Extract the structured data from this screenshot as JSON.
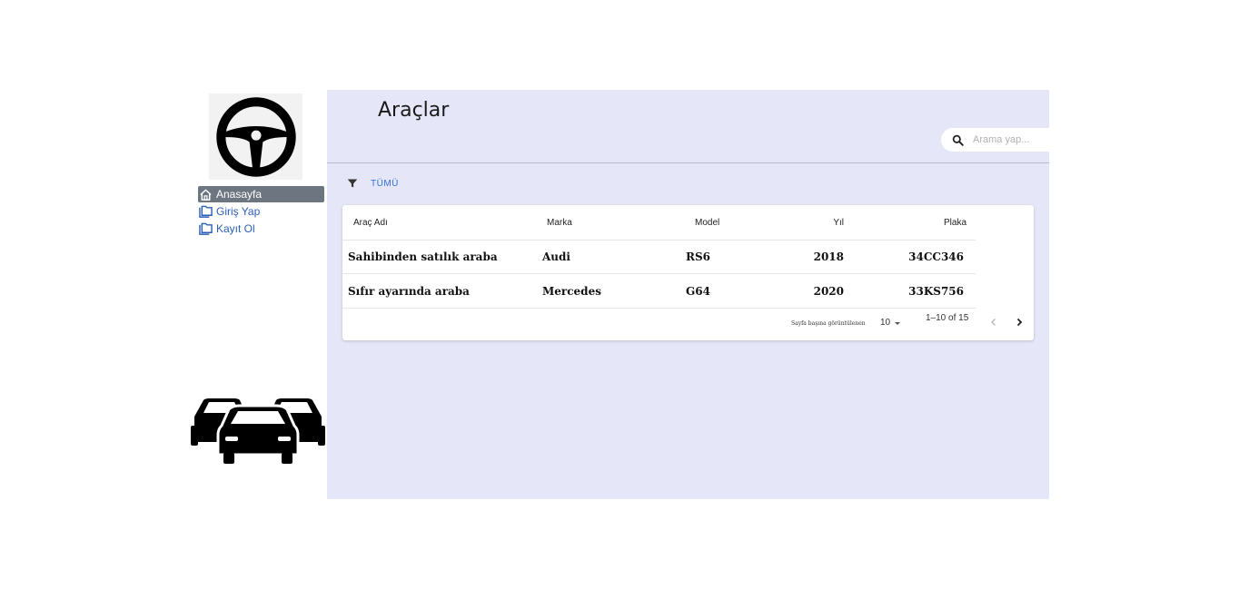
{
  "sidebar": {
    "logo_icon": "steering-wheel-icon",
    "items": [
      {
        "label": "Anasayfa",
        "icon": "home-icon",
        "active": true
      },
      {
        "label": "Giriş Yap",
        "icon": "folder-icon",
        "active": false
      },
      {
        "label": "Kayıt Ol",
        "icon": "folder-icon",
        "active": false
      }
    ],
    "bottom_icon": "cars-icon"
  },
  "main": {
    "title": "Araçlar",
    "search": {
      "placeholder": "Arama yap..."
    },
    "filter": {
      "icon": "filter-icon",
      "label": "TÜMÜ"
    },
    "table": {
      "columns": [
        "Araç Adı",
        "Marka",
        "Model",
        "Yıl",
        "Plaka"
      ],
      "rows": [
        [
          "Sahibinden satılık araba",
          "Audi",
          "RS6",
          "2018",
          "34CC346"
        ],
        [
          "Sıfır ayarında araba",
          "Mercedes",
          "G64",
          "2020",
          "33KS756"
        ]
      ]
    },
    "pagination": {
      "rows_per_page_label": "Sayfa başına görüntülenen",
      "rows_per_page_value": "10",
      "range": "1–10 of 15"
    }
  },
  "colors": {
    "main_bg": "#e5e6f7",
    "active_nav_bg": "#6c7580",
    "link": "#2a5fb8",
    "accent": "#2f6fd6"
  }
}
